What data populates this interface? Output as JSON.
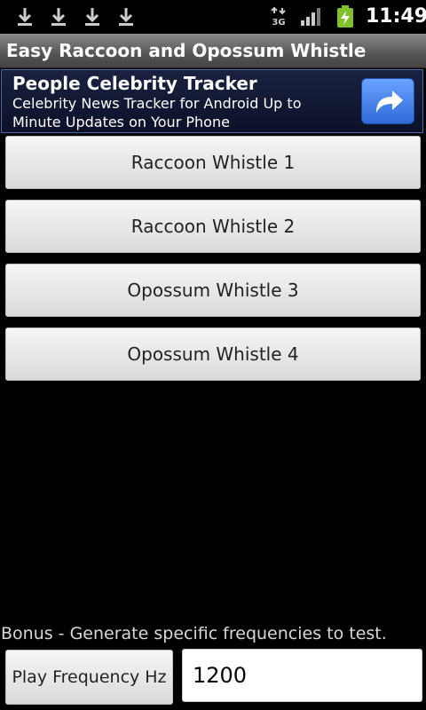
{
  "status_bar": {
    "notifications": [
      "download-icon",
      "download-icon",
      "download-icon",
      "download-icon"
    ],
    "network": "3G",
    "time": "11:49"
  },
  "app": {
    "title": "Easy Raccoon and Opossum Whistle"
  },
  "ad": {
    "title": "People Celebrity Tracker",
    "body": "Celebrity News Tracker for Android Up to Minute Updates on Your Phone",
    "action_icon": "share-arrow-icon"
  },
  "buttons": [
    {
      "label": "Raccoon Whistle 1"
    },
    {
      "label": "Raccoon Whistle 2"
    },
    {
      "label": "Opossum Whistle 3"
    },
    {
      "label": "Opossum Whistle 4"
    }
  ],
  "bonus": {
    "label": "Bonus - Generate specific frequencies to test.",
    "play_button_label": "Play Frequency Hz",
    "frequency_value": "1200"
  },
  "colors": {
    "ad_button": "#3c78e0",
    "battery": "#7ec12b"
  }
}
